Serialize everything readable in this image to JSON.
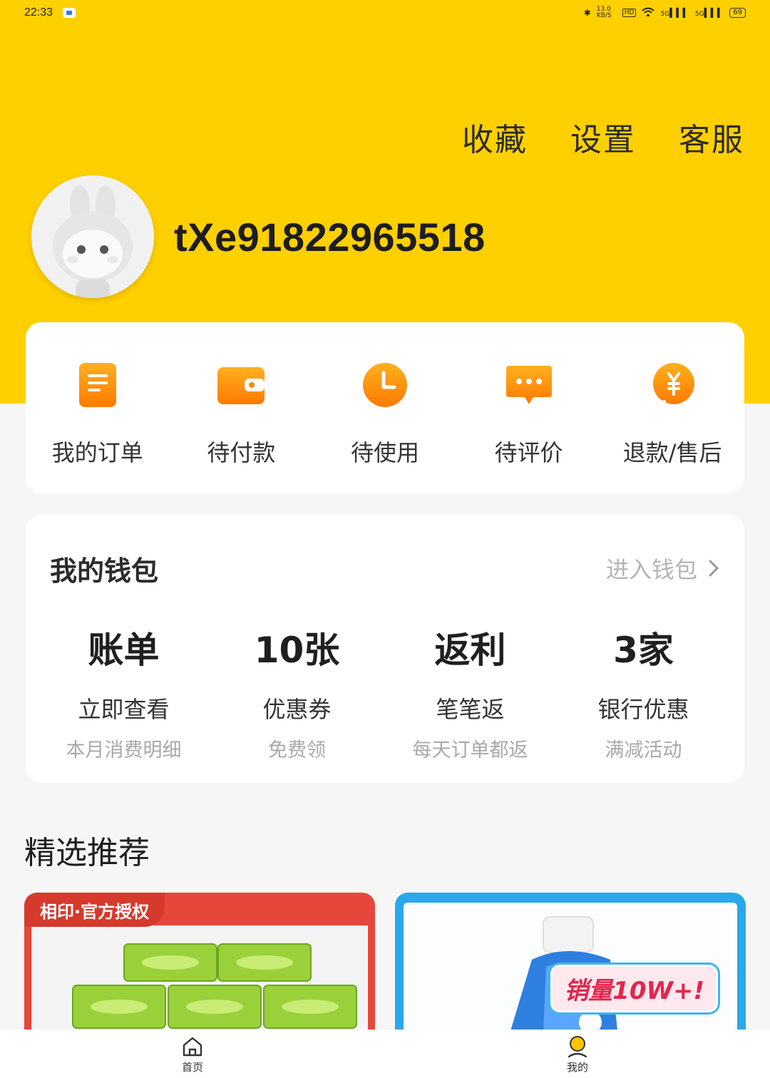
{
  "status_bar": {
    "time": "22:33",
    "net_speed": "13.0 KB/S",
    "hd": "HD",
    "signal1": "5G",
    "signal2": "5G",
    "battery": "69"
  },
  "header": {
    "actions": [
      "收藏",
      "设置",
      "客服"
    ],
    "username": "tXe91822965518"
  },
  "orders": {
    "items": [
      {
        "label": "我的订单",
        "icon": "order-list-icon"
      },
      {
        "label": "待付款",
        "icon": "wallet-icon"
      },
      {
        "label": "待使用",
        "icon": "clock-icon"
      },
      {
        "label": "待评价",
        "icon": "comment-icon"
      },
      {
        "label": "退款/售后",
        "icon": "refund-icon"
      }
    ]
  },
  "wallet": {
    "title": "我的钱包",
    "enter_label": "进入钱包",
    "columns": [
      {
        "big": "账单",
        "mid": "立即查看",
        "small": "本月消费明细"
      },
      {
        "big": "10张",
        "mid": "优惠券",
        "small": "免费领"
      },
      {
        "big": "返利",
        "mid": "笔笔返",
        "small": "每天订单都返"
      },
      {
        "big": "3家",
        "mid": "银行优惠",
        "small": "满减活动"
      }
    ]
  },
  "recommend": {
    "title": "精选推荐",
    "products": [
      {
        "badge": "相印·官方授权"
      },
      {
        "tag": "销量10W+!"
      }
    ]
  },
  "tabbar": {
    "tabs": [
      {
        "label": "首页",
        "icon": "home-icon"
      },
      {
        "label": "我的",
        "icon": "user-icon"
      }
    ]
  },
  "colors": {
    "brand_yellow": "#ffd000",
    "icon_orange": "#ff8a00"
  }
}
